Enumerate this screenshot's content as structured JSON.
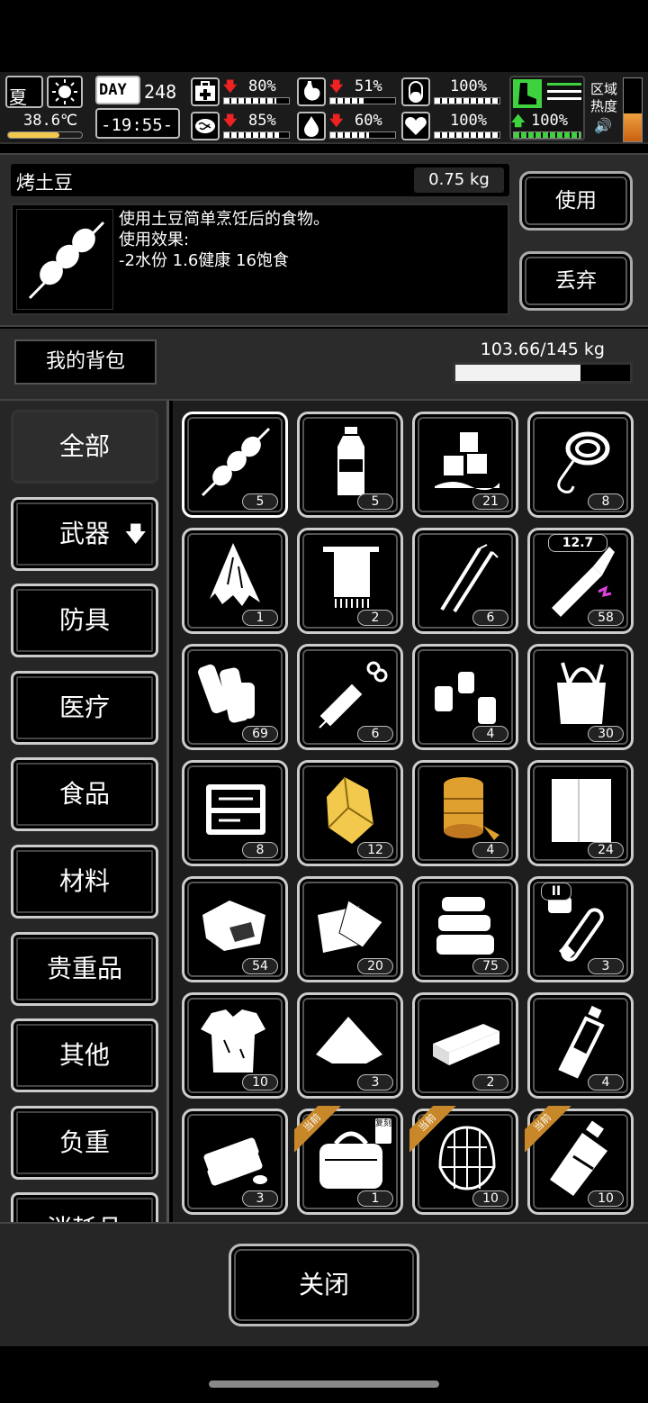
{
  "hud": {
    "season": "夏",
    "temperature": "38.6℃",
    "day_label": "DAY",
    "day_number": "248",
    "clock": "-19:55-",
    "stats": [
      {
        "key": "health",
        "value": "80%",
        "level": 0.8
      },
      {
        "key": "stomach",
        "value": "51%",
        "level": 0.51
      },
      {
        "key": "pill",
        "value": "100%",
        "level": 1.0
      },
      {
        "key": "brain",
        "value": "85%",
        "level": 0.85
      },
      {
        "key": "water",
        "value": "60%",
        "level": 0.6
      },
      {
        "key": "heart",
        "value": "100%",
        "level": 1.0
      }
    ],
    "stamina": {
      "value": "100%",
      "level": 1.0
    },
    "region_heat_label": "区域热度"
  },
  "item_detail": {
    "name": "烤土豆",
    "weight": "0.75 kg",
    "description": "使用土豆简单烹饪后的食物。\n使用效果:\n-2水份 1.6健康 16饱食",
    "use_button": "使用",
    "drop_button": "丢弃"
  },
  "bag": {
    "label": "我的背包",
    "weight": "103.66/145 kg",
    "fill": 0.715
  },
  "categories": [
    {
      "label": "全部",
      "active": true
    },
    {
      "label": "武器",
      "arrow": "🡇"
    },
    {
      "label": "防具"
    },
    {
      "label": "医疗"
    },
    {
      "label": "食品"
    },
    {
      "label": "材料"
    },
    {
      "label": "贵重品"
    },
    {
      "label": "其他"
    },
    {
      "label": "负重"
    },
    {
      "label": "消耗品"
    }
  ],
  "items": [
    {
      "icon": "baked-potato-skewer-icon",
      "count": "5"
    },
    {
      "icon": "water-bottle-icon",
      "count": "5"
    },
    {
      "icon": "ice-cubes-icon",
      "count": "21"
    },
    {
      "icon": "rope-hook-icon",
      "count": "8"
    },
    {
      "icon": "torn-cloth-icon",
      "count": "1"
    },
    {
      "icon": "towel-icon",
      "count": "2"
    },
    {
      "icon": "lockpicks-icon",
      "count": "6"
    },
    {
      "icon": "bullet-icon",
      "count": "58",
      "caliber": "12.7"
    },
    {
      "icon": "paper-scrolls-icon",
      "count": "69"
    },
    {
      "icon": "syringe-icon",
      "count": "6"
    },
    {
      "icon": "pill-bottles-icon",
      "count": "4"
    },
    {
      "icon": "tool-bag-icon",
      "count": "30"
    },
    {
      "icon": "toolbox-icon",
      "count": "8"
    },
    {
      "icon": "gold-nugget-icon",
      "count": "12"
    },
    {
      "icon": "tape-roll-icon",
      "count": "4"
    },
    {
      "icon": "cloth-sheet-icon",
      "count": "24"
    },
    {
      "icon": "meat-chunk-icon",
      "count": "54"
    },
    {
      "icon": "paper-sheets-icon",
      "count": "20"
    },
    {
      "icon": "folded-clothes-icon",
      "count": "75"
    },
    {
      "icon": "test-tube-icon",
      "count": "3",
      "tube_label": "II"
    },
    {
      "icon": "ragged-shirt-icon",
      "count": "10"
    },
    {
      "icon": "powder-pile-icon",
      "count": "3"
    },
    {
      "icon": "bar-block-icon",
      "count": "2"
    },
    {
      "icon": "glass-bottle-icon",
      "count": "4"
    },
    {
      "icon": "crackers-icon",
      "count": "3"
    },
    {
      "icon": "duffel-bag-icon",
      "count": "1",
      "badge": "当前",
      "copy": "复刻"
    },
    {
      "icon": "net-bag-icon",
      "count": "10",
      "badge": "当前"
    },
    {
      "icon": "water-pouch-icon",
      "count": "10",
      "badge": "当前"
    }
  ],
  "footer": {
    "close_button": "关闭"
  },
  "colors": {
    "badge": "#c8882a",
    "health_down": "#e22222",
    "stamina": "#3fd23f",
    "gold": "#f2c94c",
    "tape": "#e0a030"
  }
}
